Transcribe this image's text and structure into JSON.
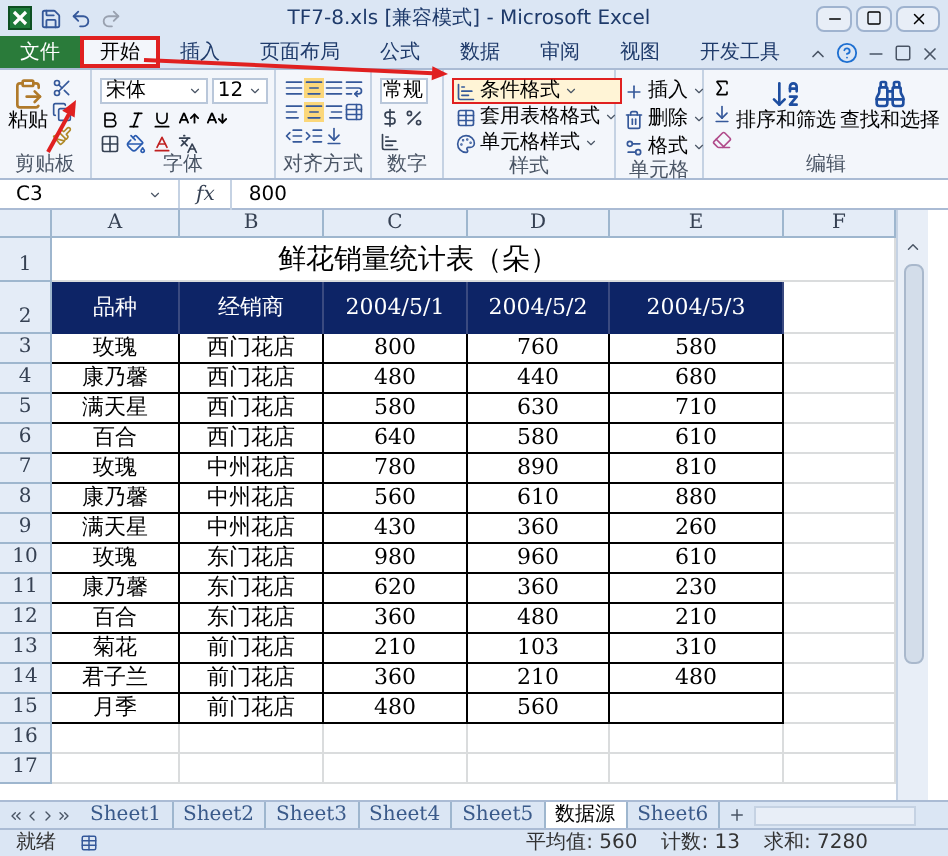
{
  "window": {
    "title": "TF7-8.xls [兼容模式] - Microsoft Excel"
  },
  "ribbon_tabs": [
    {
      "label": "文件",
      "kind": "file",
      "selected": false,
      "highlighted": false
    },
    {
      "label": "开始",
      "kind": "tab",
      "selected": true,
      "highlighted": true
    },
    {
      "label": "插入",
      "kind": "tab",
      "selected": false,
      "highlighted": false
    },
    {
      "label": "页面布局",
      "kind": "tab",
      "selected": false,
      "highlighted": false
    },
    {
      "label": "公式",
      "kind": "tab",
      "selected": false,
      "highlighted": false
    },
    {
      "label": "数据",
      "kind": "tab",
      "selected": false,
      "highlighted": false
    },
    {
      "label": "审阅",
      "kind": "tab",
      "selected": false,
      "highlighted": false
    },
    {
      "label": "视图",
      "kind": "tab",
      "selected": false,
      "highlighted": false
    },
    {
      "label": "开发工具",
      "kind": "tab",
      "selected": false,
      "highlighted": false
    }
  ],
  "ribbon": {
    "clipboard": {
      "paste": "粘贴",
      "label": "剪贴板"
    },
    "font": {
      "name": "宋体",
      "size": "12",
      "label": "字体"
    },
    "alignment": {
      "label": "对齐方式"
    },
    "number": {
      "format": "常规",
      "label": "数字"
    },
    "styles": {
      "items": [
        {
          "label": "条件格式",
          "highlighted": true
        },
        {
          "label": "套用表格格式",
          "highlighted": false
        },
        {
          "label": "单元格样式",
          "highlighted": false
        }
      ],
      "label": "样式"
    },
    "cells": {
      "items": [
        "插入",
        "删除",
        "格式"
      ],
      "label": "单元格"
    },
    "editing": {
      "items": [
        "排序和筛选",
        "查找和选择"
      ],
      "label": "编辑"
    }
  },
  "formula_bar": {
    "name_box": "C3",
    "function_label": "fx",
    "formula": "800"
  },
  "columns": [
    "A",
    "B",
    "C",
    "D",
    "E",
    "F"
  ],
  "sheet": {
    "title": "鲜花销量统计表（朵）",
    "header": [
      "品种",
      "经销商",
      "2004/5/1",
      "2004/5/2",
      "2004/5/3"
    ],
    "rows": [
      [
        "玫瑰",
        "西门花店",
        "800",
        "760",
        "580"
      ],
      [
        "康乃馨",
        "西门花店",
        "480",
        "440",
        "680"
      ],
      [
        "满天星",
        "西门花店",
        "580",
        "630",
        "710"
      ],
      [
        "百合",
        "西门花店",
        "640",
        "580",
        "610"
      ],
      [
        "玫瑰",
        "中州花店",
        "780",
        "890",
        "810"
      ],
      [
        "康乃馨",
        "中州花店",
        "560",
        "610",
        "880"
      ],
      [
        "满天星",
        "中州花店",
        "430",
        "360",
        "260"
      ],
      [
        "玫瑰",
        "东门花店",
        "980",
        "960",
        "610"
      ],
      [
        "康乃馨",
        "东门花店",
        "620",
        "360",
        "230"
      ],
      [
        "百合",
        "东门花店",
        "360",
        "480",
        "210"
      ],
      [
        "菊花",
        "前门花店",
        "210",
        "103",
        "310"
      ],
      [
        "君子兰",
        "前门花店",
        "360",
        "210",
        "480"
      ],
      [
        "月季",
        "前门花店",
        "480",
        "560"
      ]
    ]
  },
  "row_numbers": [
    "1",
    "2",
    "3",
    "4",
    "5",
    "6",
    "7",
    "8",
    "9",
    "10",
    "11",
    "12",
    "13",
    "14",
    "15",
    "16",
    "17"
  ],
  "sheet_tabs": [
    {
      "label": "Sheet1",
      "selected": false
    },
    {
      "label": "Sheet2",
      "selected": false
    },
    {
      "label": "Sheet3",
      "selected": false
    },
    {
      "label": "Sheet4",
      "selected": false
    },
    {
      "label": "Sheet5",
      "selected": false
    },
    {
      "label": "数据源",
      "selected": true
    },
    {
      "label": "Sheet6",
      "selected": false
    }
  ],
  "status_bar": {
    "state": "就绪",
    "average": "平均值: 560",
    "count": "计数: 13",
    "sum": "求和: 7280"
  }
}
